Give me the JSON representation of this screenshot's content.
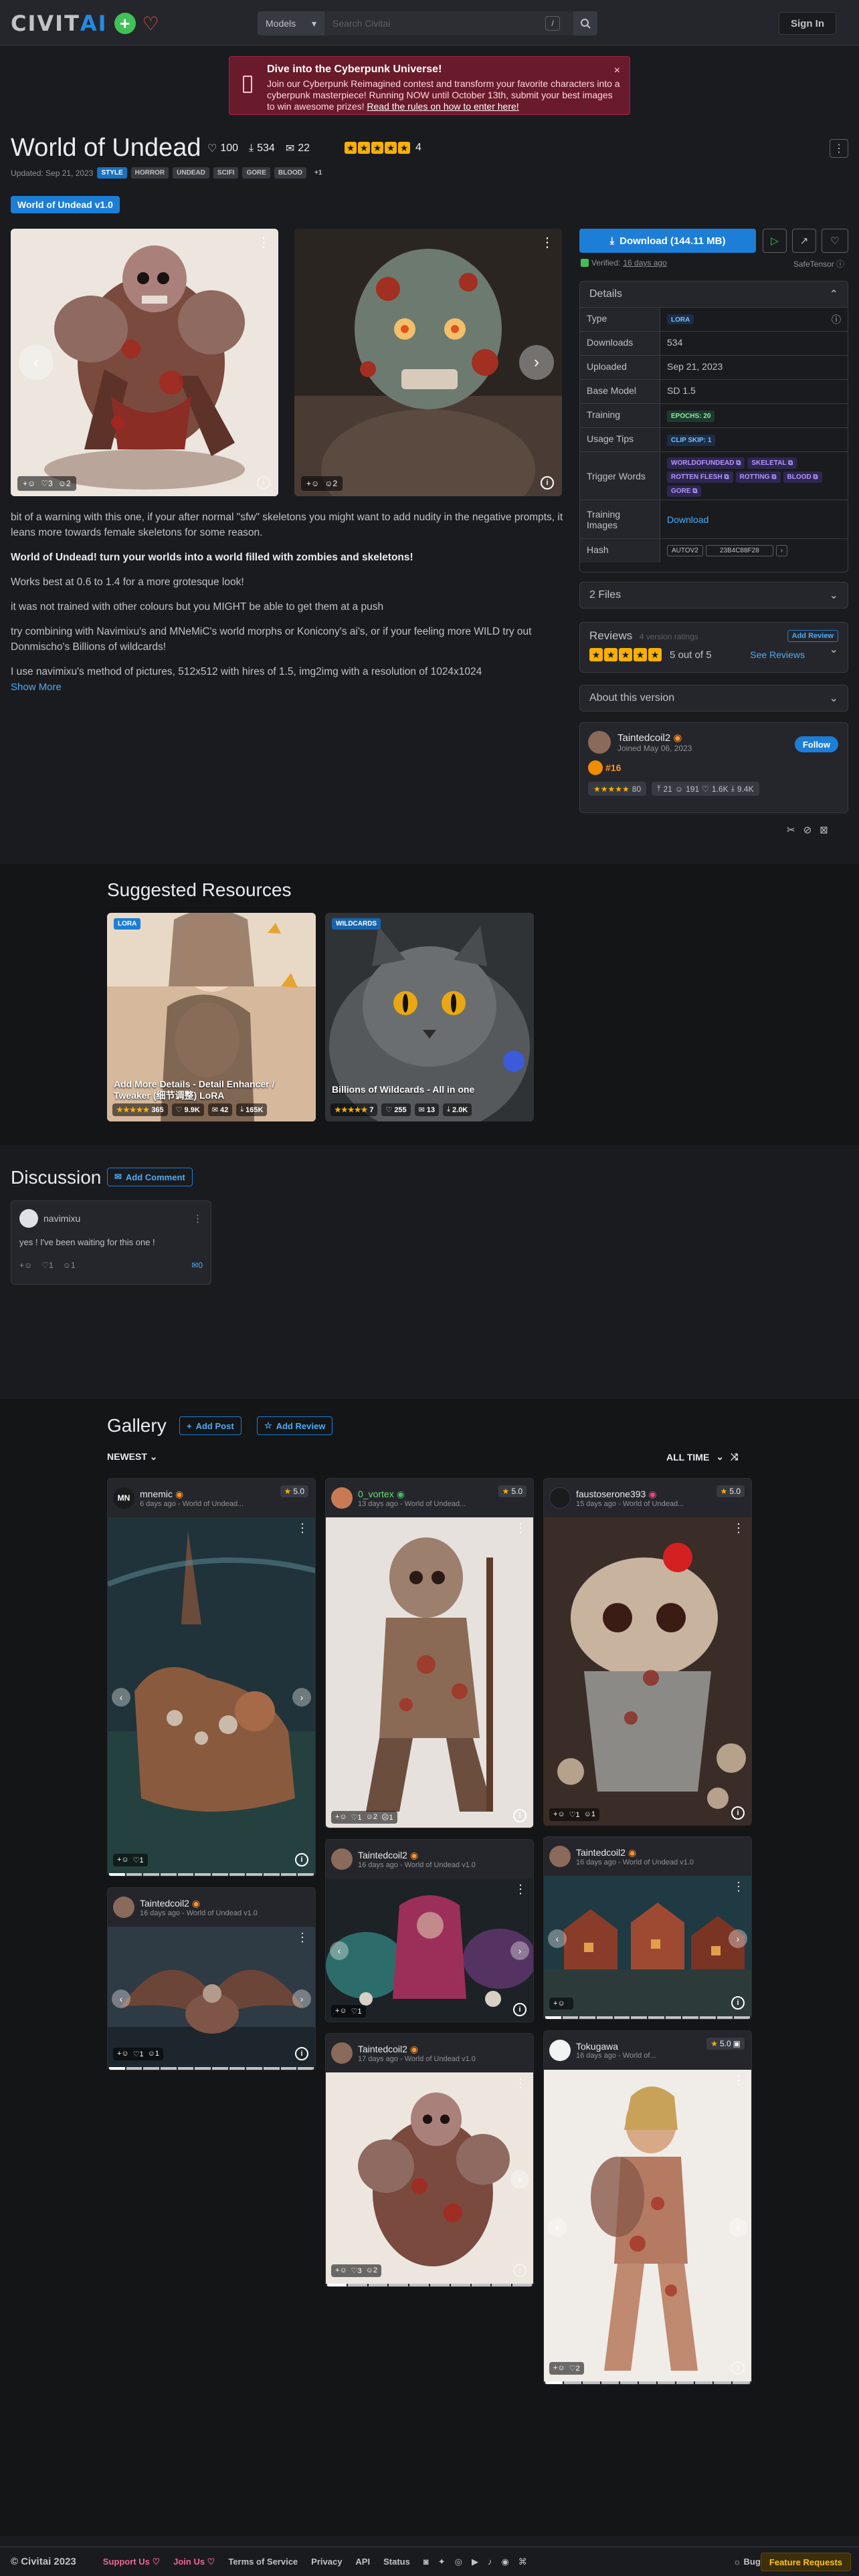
{
  "header": {
    "logo_text_a": "CIVIT",
    "logo_text_b": "AI",
    "search_type": "Models",
    "search_placeholder": "Search Civitai",
    "search_shortcut": "/",
    "signin_label": "Sign In"
  },
  "alert": {
    "title": "Dive into the Cyberpunk Universe!",
    "body": "Join our Cyberpunk Reimagined contest and transform your favorite characters into a cyberpunk masterpiece! Running NOW until October 13th, submit your best images to win awesome prizes!",
    "link": "Read the rules on how to enter here!",
    "close": "×"
  },
  "model": {
    "title": "World of Undead",
    "likes": "100",
    "downloads": "534",
    "comments": "22",
    "rating_count": "4",
    "updated": "Updated: Sep 21, 2023",
    "tags": [
      "STYLE",
      "HORROR",
      "UNDEAD",
      "SCIFI",
      "GORE",
      "BLOOD",
      "+1"
    ],
    "version_button": "World of Undead v1.0"
  },
  "hero": [
    {
      "reactions": [
        "3",
        "2"
      ]
    },
    {
      "reactions": [
        "2"
      ]
    }
  ],
  "description": {
    "p1": "bit of a warning with this one, if your after normal \"sfw\" skeletons you might want to add nudity in the negative prompts, it leans more towards female skeletons for some reason.",
    "p2": "World of Undead! turn your worlds into a world filled with zombies and skeletons!",
    "p3": "Works best at 0.6 to 1.4 for a more grotesque look!",
    "p4": "it was not trained with other colours but you MIGHT be able to get them at a push",
    "p5": "try combining with Navimixu's and MNeMiC's world morphs or Konicony's ai's, or if your feeling more WILD try out Donmischo's Billions of wildcards!",
    "p6": "I use navimixu's method of pictures, 512x512 with hires of 1.5, img2img with a resolution of 1024x1024",
    "show_more": "Show More"
  },
  "sidebar": {
    "download_label": "Download (144.11 MB)",
    "verified": "Verified:",
    "verified_when": "16 days ago",
    "safetensor": "SafeTensor",
    "details_title": "Details",
    "rows": {
      "type_k": "Type",
      "type_v": "LORA",
      "downloads_k": "Downloads",
      "downloads_v": "534",
      "uploaded_k": "Uploaded",
      "uploaded_v": "Sep 21, 2023",
      "base_k": "Base Model",
      "base_v": "SD 1.5",
      "training_k": "Training",
      "training_v": "EPOCHS: 20",
      "usage_k": "Usage Tips",
      "usage_v": "CLIP SKIP: 1",
      "trigger_k": "Trigger Words",
      "triggers": [
        "WORLDOFUNDEAD",
        "SKELETAL",
        "ROTTEN FLESH",
        "ROTTING",
        "BLOOD",
        "GORE"
      ],
      "timages_k": "Training Images",
      "timages_v": "Download",
      "hash_k": "Hash",
      "hash_type": "AUTOV2",
      "hash_v": "23B4C88F28"
    },
    "files": "2 Files",
    "reviews_title": "Reviews",
    "reviews_sub": "4 version ratings",
    "reviews_score": "5 out of 5",
    "add_review": "Add Review",
    "see_reviews": "See Reviews",
    "about": "About this version",
    "creator_name": "Taintedcoil2",
    "creator_joined": "Joined May 06, 2023",
    "follow": "Follow",
    "rank": "#16",
    "creator_rating": "80",
    "creator_stats": [
      "21",
      "191",
      "1.6K",
      "9.4K"
    ]
  },
  "suggested": {
    "title": "Suggested Resources",
    "cards": [
      {
        "label": "LORA",
        "title": "Add More Details - Detail Enhancer / Tweaker (细节调整) LoRA",
        "rating": "365",
        "likes": "9.9K",
        "comments": "42",
        "downloads": "165K",
        "color": "#1c7ed6"
      },
      {
        "label": "WILDCARDS",
        "title": "Billions of Wildcards - All in one",
        "rating": "7",
        "likes": "255",
        "comments": "13",
        "downloads": "2.0K",
        "color": "#1864ab"
      }
    ]
  },
  "discussion": {
    "title": "Discussion",
    "add_comment": "Add Comment",
    "comment_user": "navimixu",
    "comment_text": "yes ! I've been waiting for this one !",
    "comment_r1": "1",
    "comment_r2": "1",
    "comment_replies": "0"
  },
  "gallery": {
    "title": "Gallery",
    "add_post": "Add Post",
    "add_review": "Add Review",
    "sort": "NEWEST",
    "period": "ALL TIME",
    "cards": [
      {
        "user": "mnemic",
        "initials": "MN",
        "sub": "6 days ago - World of Undead...",
        "rating": "5.0",
        "reacts": [
          "1"
        ]
      },
      {
        "user": "0_vortex",
        "sub": "13 days ago - World of Undead...",
        "rating": "5.0",
        "reacts": [
          "1",
          "2",
          "1"
        ]
      },
      {
        "user": "faustoserone393",
        "sub": "15 days ago - World of Undead...",
        "rating": "5.0",
        "reacts": [
          "1",
          "1"
        ]
      },
      {
        "user": "Taintedcoil2",
        "sub": "16 days ago - World of Undead v1.0",
        "reacts": [
          "1",
          "1"
        ]
      },
      {
        "user": "Taintedcoil2",
        "sub": "16 days ago - World of Undead v1.0",
        "reacts": [
          "1"
        ]
      },
      {
        "user": "Taintedcoil2",
        "sub": "16 days ago - World of Undead v1.0",
        "reacts": [
          ""
        ]
      },
      {
        "user": "Taintedcoil2",
        "sub": "17 days ago - World of Undead v1.0",
        "reacts": [
          "3",
          "2"
        ]
      },
      {
        "user": "Tokugawa",
        "sub": "16 days ago - World of...",
        "rating": "5.0",
        "reacts": [
          "2"
        ]
      }
    ]
  },
  "footer": {
    "brand": "© Civitai 2023",
    "links": [
      "Support Us ♡",
      "Join Us ♡",
      "Terms of Service",
      "Privacy",
      "API",
      "Status"
    ],
    "bugs": "☼ Bugs",
    "feature": "Feature Requests"
  }
}
